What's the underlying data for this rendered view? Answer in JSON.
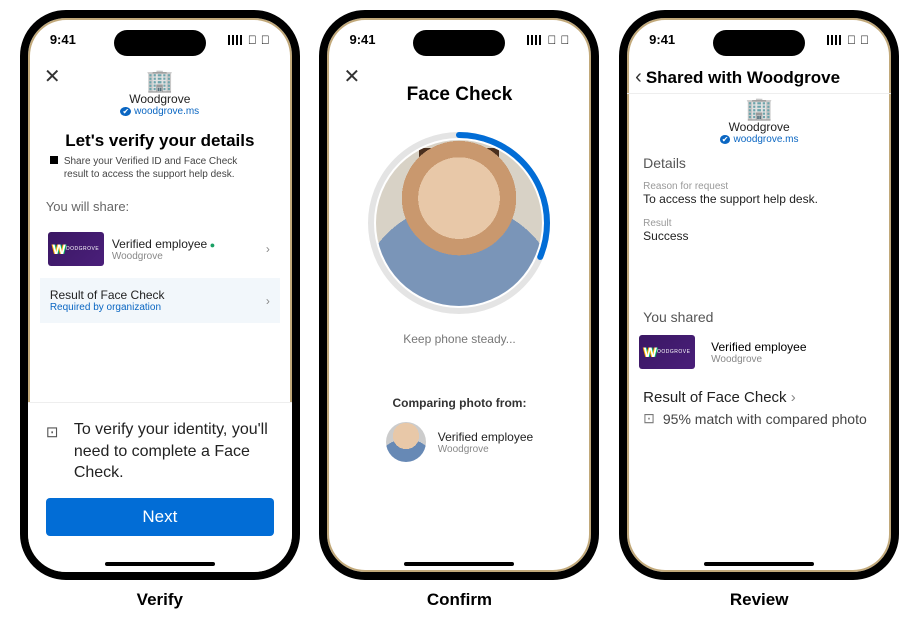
{
  "status_time": "9:41",
  "captions": {
    "verify": "Verify",
    "confirm": "Confirm",
    "review": "Review"
  },
  "org": {
    "name": "Woodgrove",
    "domain": "woodgrove.ms"
  },
  "verify": {
    "heading": "Let's verify your details",
    "sub": "Share your Verified ID and Face Check result to access the support help desk.",
    "share_label": "You will share:",
    "card": {
      "title": "Verified employee",
      "issuer": "Woodgrove"
    },
    "face_row": {
      "title": "Result of Face Check",
      "sub": "Required by organization"
    },
    "bottom_text": "To verify your identity, you'll need to complete a Face Check.",
    "next_label": "Next"
  },
  "confirm": {
    "title": "Face Check",
    "steady": "Keep phone steady...",
    "comparing": "Comparing photo from:",
    "card": {
      "title": "Verified employee",
      "issuer": "Woodgrove"
    }
  },
  "review": {
    "header": "Shared with Woodgrove",
    "details_label": "Details",
    "reason_label": "Reason for request",
    "reason": "To access the support help desk.",
    "result_label": "Result",
    "result": "Success",
    "shared_label": "You shared",
    "card": {
      "title": "Verified employee",
      "issuer": "Woodgrove"
    },
    "res_title": "Result of Face Check",
    "res_body": "95% match with compared photo"
  }
}
